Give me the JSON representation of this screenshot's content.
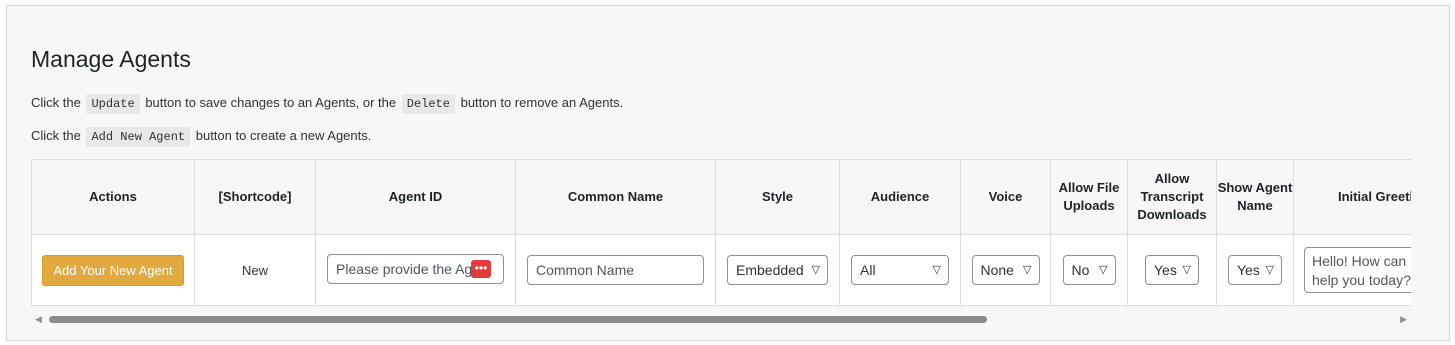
{
  "page": {
    "title": "Manage Agents",
    "desc1_pre": "Click the",
    "desc1_code1": "Update",
    "desc1_mid": "button to save changes to an Agents, or the",
    "desc1_code2": "Delete",
    "desc1_post": "button to remove an Agents.",
    "desc2_pre": "Click the",
    "desc2_code": "Add New Agent",
    "desc2_post": "button to create a new Agents."
  },
  "table": {
    "headers": {
      "actions": "Actions",
      "shortcode": "[Shortcode]",
      "agent_id": "Agent ID",
      "common_name": "Common Name",
      "style": "Style",
      "audience": "Audience",
      "voice": "Voice",
      "allow_file_uploads": "Allow File Uploads",
      "allow_transcript_downloads": "Allow Transcript Downloads",
      "show_agent_name": "Show Agent Name",
      "initial_greeting": "Initial Greeting"
    },
    "row": {
      "add_button": "Add Your New Agent",
      "shortcode": "New",
      "agent_id_placeholder": "Please provide the Agent ID",
      "common_name_placeholder": "Common Name",
      "style": "Embedded",
      "audience": "All",
      "voice": "None",
      "allow_file_uploads": "No",
      "allow_transcript_downloads": "Yes",
      "show_agent_name": "Yes",
      "initial_greeting": "Hello! How can I help you today?"
    }
  },
  "icons": {
    "chevron": "chevron-down-icon",
    "password_manager": "ellipsis-icon"
  },
  "colors": {
    "add_button": "#e2a93f",
    "badge": "#e33b3b"
  }
}
